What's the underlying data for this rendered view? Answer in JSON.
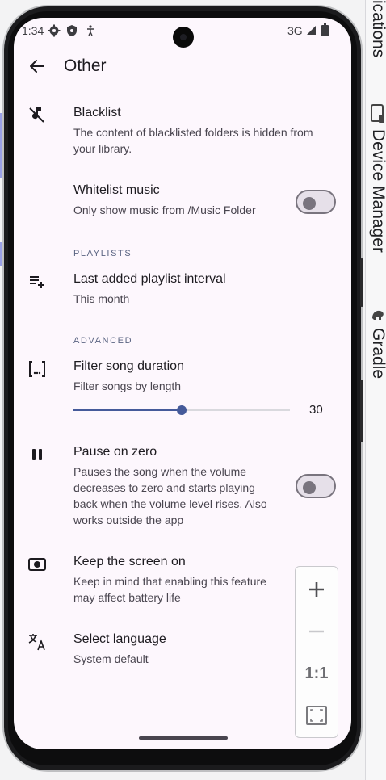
{
  "status_bar": {
    "time": "1:34",
    "network": "3G"
  },
  "app_bar": {
    "title": "Other"
  },
  "settings": {
    "blacklist": {
      "title": "Blacklist",
      "subtitle_line1": "The content of blacklisted folders is hidden from",
      "subtitle_line2": "your library."
    },
    "whitelist": {
      "title": "Whitelist music",
      "subtitle": "Only show music from /Music Folder",
      "enabled": false
    },
    "playlists_header": "PLAYLISTS",
    "last_added": {
      "title": "Last added playlist interval",
      "subtitle": "This month"
    },
    "advanced_header": "ADVANCED",
    "filter_duration": {
      "title": "Filter song duration",
      "subtitle": "Filter songs by length",
      "value": "30"
    },
    "pause_on_zero": {
      "title": "Pause on zero",
      "line1": "Pauses the song when the volume",
      "line2": "decreases to zero and starts playing",
      "line3": "back when the volume level rises. Also",
      "line4": "works outside the app",
      "enabled": false
    },
    "keep_screen_on": {
      "title": "Keep the screen on",
      "line1": "Keep in mind that enabling this feature",
      "line2": "may affect battery life"
    },
    "select_language": {
      "title": "Select language",
      "subtitle": "System default"
    }
  },
  "emulator_controls": {
    "zoom_in": "+",
    "zoom_out": "−",
    "actual_size": "1:1"
  },
  "ide_side_panel": {
    "item1": "ications",
    "item2": "Device Manager",
    "item3": "Gradle"
  }
}
